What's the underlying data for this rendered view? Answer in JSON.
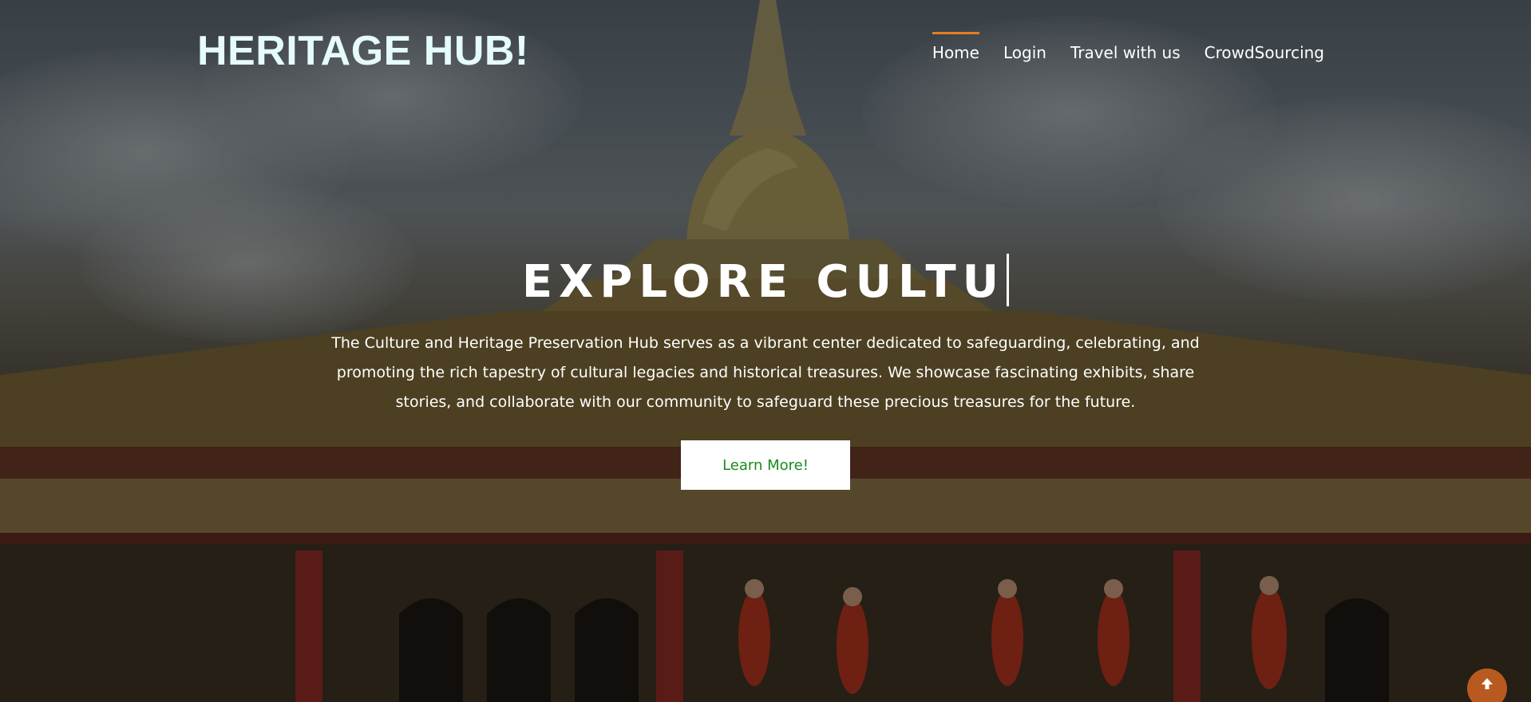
{
  "brand": {
    "title": "HERITAGE HUB!"
  },
  "nav": {
    "items": [
      {
        "label": "Home",
        "active": true
      },
      {
        "label": "Login",
        "active": false
      },
      {
        "label": "Travel with us",
        "active": false
      },
      {
        "label": "CrowdSourcing",
        "active": false
      }
    ]
  },
  "hero": {
    "title": "EXPLORE CULTU",
    "description": "The Culture and Heritage Preservation Hub serves as a vibrant center dedicated to safeguarding, celebrating, and promoting the rich tapestry of cultural legacies and historical treasures. We showcase fascinating exhibits, share stories, and collaborate with our community to safeguard these precious treasures for the future.",
    "cta_label": "Learn More!"
  },
  "icons": {
    "back_to_top": "arrow-up-icon",
    "background": "pagoda-image"
  },
  "colors": {
    "accent": "#e57d22",
    "brand_text": "#e6fbfb",
    "cta_text": "#188a1e",
    "back_to_top": "#b85a1f"
  }
}
